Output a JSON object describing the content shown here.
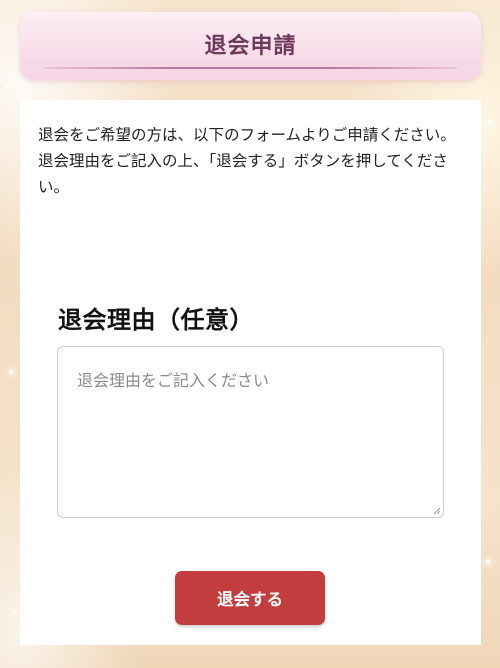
{
  "header": {
    "title": "退会申請"
  },
  "intro": {
    "text": "退会をご希望の方は、以下のフォームよりご申請ください。退会理由をご記入の上、「退会する」ボタンを押してください。"
  },
  "form": {
    "reason_label": "退会理由（任意）",
    "reason_placeholder": "退会理由をご記入ください",
    "reason_value": "",
    "submit_label": "退会する"
  },
  "colors": {
    "title_text": "#6e3a5c",
    "button_background": "#c23d3d",
    "header_background": "#f8dde9"
  }
}
